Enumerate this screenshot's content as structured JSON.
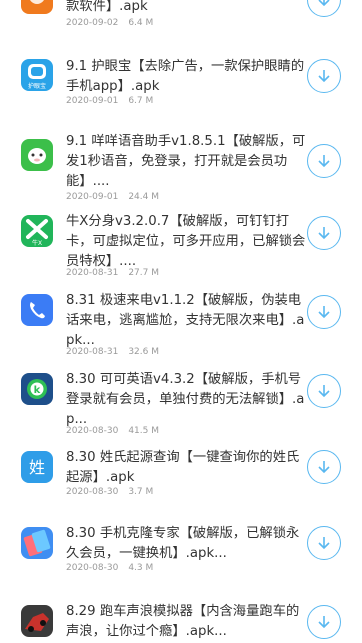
{
  "items": [
    {
      "title": "款软件】.apk",
      "date": "2020-09-02",
      "size": "6.4 M",
      "icon": "orange-app-icon"
    },
    {
      "title": "9.1 护眼宝【去除广告，一款保护眼睛的手机app】.apk",
      "date": "2020-09-01",
      "size": "6.7 M",
      "icon": "eye-protect-icon",
      "icon_text": "护眼宝"
    },
    {
      "title": "9.1 咩咩语音助手v1.8.5.1【破解版，可发1秒语音，免登录，打开就是会员功能】....",
      "date": "2020-09-01",
      "size": "24.4 M",
      "icon": "sheep-icon"
    },
    {
      "title": "牛X分身v3.2.0.7【破解版，可钉钉打卡，可虚拟定位，可多开应用，已解锁会员特权】....",
      "date": "2020-08-31",
      "size": "27.7 M",
      "icon": "nx-clone-icon",
      "icon_text": "牛X"
    },
    {
      "title": "8.31 极速来电v1.1.2【破解版，伪装电话来电，逃离尴尬，支持无限次来电】.apk...",
      "date": "2020-08-31",
      "size": "32.6 M",
      "icon": "phone-icon"
    },
    {
      "title": "8.30 可可英语v4.3.2【破解版，手机号登录就有会员，单独付费的无法解锁】.ap...",
      "date": "2020-08-30",
      "size": "41.5 M",
      "icon": "keke-english-icon",
      "icon_text": "k"
    },
    {
      "title": "8.30 姓氏起源查询【一键查询你的姓氏起源】.apk",
      "date": "2020-08-30",
      "size": "3.7 M",
      "icon": "surname-icon",
      "icon_text": "姓"
    },
    {
      "title": "8.30 手机克隆专家【破解版，已解锁永久会员，一键换机】.apk...",
      "date": "2020-08-30",
      "size": "4.3 M",
      "icon": "phone-clone-icon"
    },
    {
      "title": "8.29 跑车声浪模拟器【内含海量跑车的声浪，让你过个瘾】.apk...",
      "date": "",
      "size": "",
      "icon": "sports-car-icon"
    }
  ],
  "download_icon": "download-arrow-icon",
  "colors": {
    "accent": "#5ab8f0",
    "meta": "#9a9a9a",
    "title": "#333333"
  }
}
